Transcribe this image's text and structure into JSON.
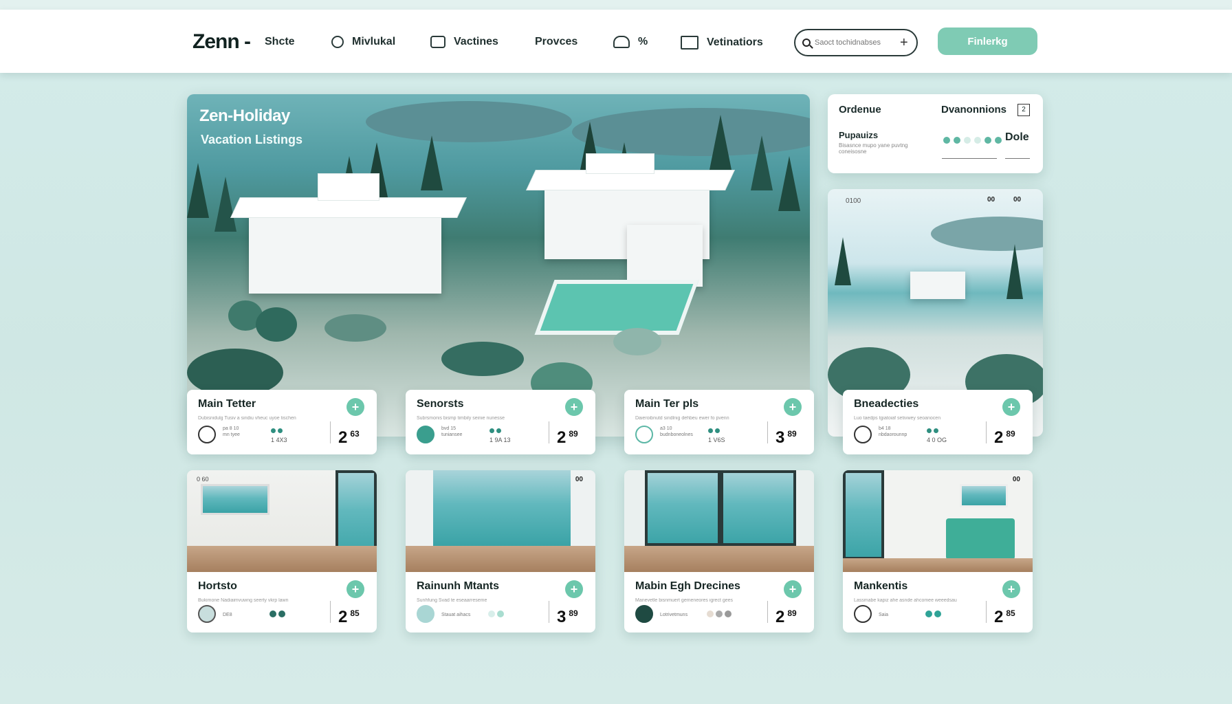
{
  "brand": {
    "logo": "Zenn -"
  },
  "nav": {
    "items": [
      {
        "label": "Shcte",
        "icon": ""
      },
      {
        "label": "Mivlukal",
        "icon": "compass-icon"
      },
      {
        "label": "Vactines",
        "icon": "calendar-icon"
      },
      {
        "label": "Provces",
        "icon": ""
      },
      {
        "label": "%",
        "icon": "house-icon"
      },
      {
        "label": "Vetinatiors",
        "icon": "car-icon"
      }
    ],
    "search_placeholder": "Saoct tochidnabses",
    "cta_label": "Finlerkg"
  },
  "hero": {
    "title": "Zen-Holiday",
    "subtitle": "Vacation Listings"
  },
  "filter_panel": {
    "order_label": "Ordenue",
    "destination_label": "Dvanonnions",
    "badge": "2",
    "popular_label": "Pupauizs",
    "popular_hint": "Bisasnce mupo yane puvtng coneisosne",
    "date_label": "Dole"
  },
  "side_image": {
    "code": "0100",
    "dots_a": "00",
    "dots_b": "00"
  },
  "listings": [
    {
      "title": "Main Tetter",
      "sub": "Dubisnidulg  Tusiv a sindiu vheuc uyoe tischen",
      "meta1": "pa 8 10",
      "meta2": "mn tyee",
      "code": "1 4X3",
      "price_main": "2",
      "price_cents": "63"
    },
    {
      "title": "Senorsts",
      "sub": "Subrsmonis  bismp timbily seinie nunesse",
      "meta1": "bvd 15",
      "meta2": "tuniansee",
      "code": "1 9A 13",
      "price_main": "2",
      "price_cents": "89"
    },
    {
      "title": "Main Ter pls",
      "sub": "Daieroibnutd  sindlnig dehbeu ewer fo pvenn",
      "meta1": "a3 10",
      "meta2": "budnboneolnes",
      "code": "1 V6S",
      "price_main": "3",
      "price_cents": "89"
    },
    {
      "title": "Bneadecties",
      "sub": "Luo taedps  tgiatoiaf setivwey seoanocen",
      "meta1": "b4 18",
      "meta2": "nbdaorounnp",
      "code": "4 0 OG",
      "price_main": "2",
      "price_cents": "89"
    }
  ],
  "rooms": [
    {
      "code": "0 60",
      "dots": "",
      "title": "Hortsto",
      "sub": "Bukimone  Nadiaimvuwng seerty vkrp lawn",
      "meta": "DE8",
      "price_main": "2",
      "price_cents": "85"
    },
    {
      "code": "",
      "dots": "00",
      "title": "Rainunh Mtants",
      "sub": "Sunhfung  Svad te eseaarreseme",
      "meta": "Stauat aihacs",
      "price_main": "3",
      "price_cents": "89"
    },
    {
      "code": "",
      "dots": "",
      "title": "Mabin Egh Drecines",
      "sub": "Manevetle  bisnmuert gemeneores igrect gees",
      "meta": "Lotrivetmuns",
      "price_main": "2",
      "price_cents": "89"
    },
    {
      "code": "",
      "dots": "00",
      "title": "Mankentis",
      "sub": "Lassmabe  kapiz ahe asnde ahcomee weeedsaun",
      "meta": "Saia",
      "price_main": "2",
      "price_cents": "85"
    }
  ],
  "colors": {
    "accent": "#6cc7ac",
    "dark_teal": "#2f8f80",
    "background": "#d4ecea"
  }
}
